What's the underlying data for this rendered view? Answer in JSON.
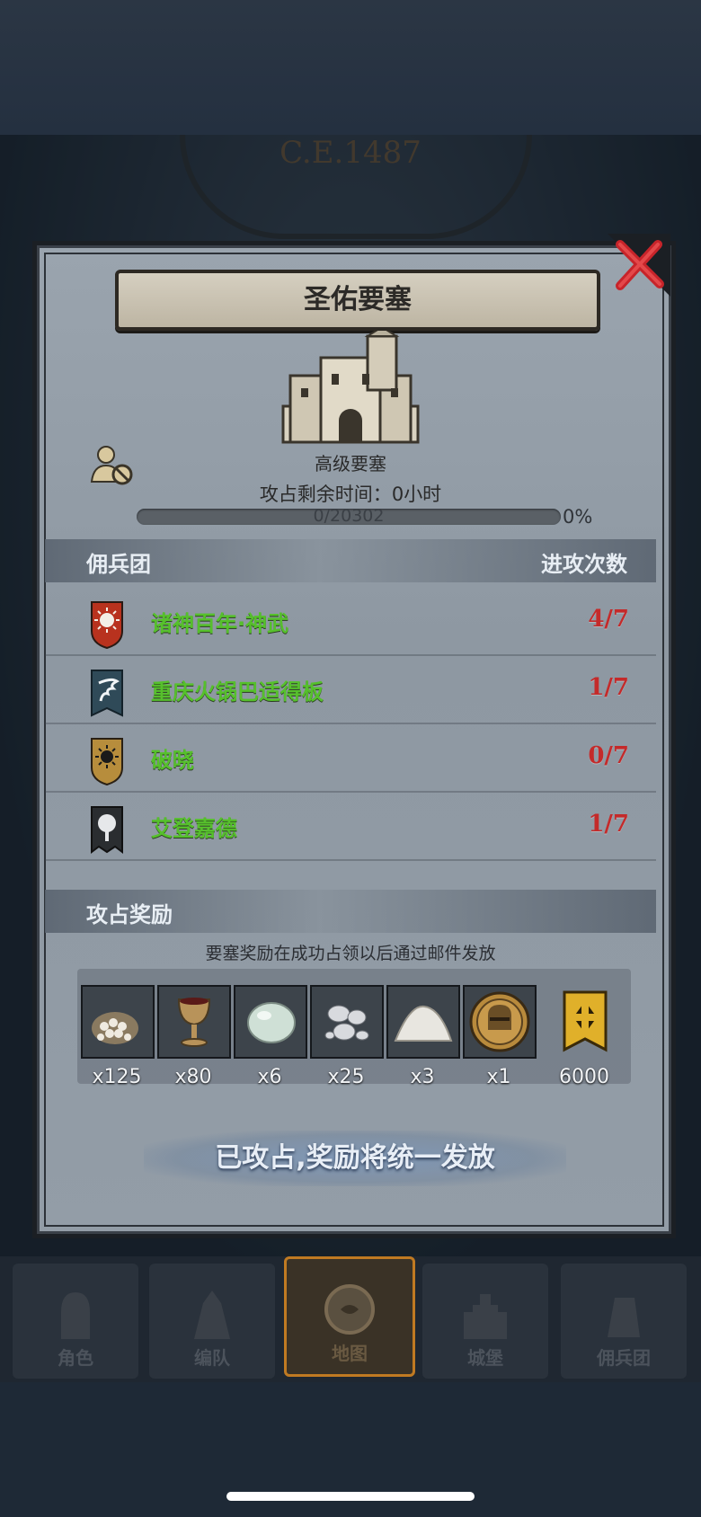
{
  "era": "C.E.1487",
  "dialog": {
    "title": "圣佑要塞",
    "castle_type": "高级要塞",
    "occupy_time_label": "攻占剩余时间：",
    "occupy_time_value": "0",
    "occupy_time_unit": "小时",
    "progress_text": "0/20302",
    "progress_pct": "0%",
    "progress_fraction": 0
  },
  "mercenary_section": {
    "label": "佣兵团",
    "count_label": "进攻次数"
  },
  "mercenaries": [
    {
      "name": "诸神百年·神武",
      "count": "4/7",
      "shield": "sun-shield-icon",
      "color": "#b8321e"
    },
    {
      "name": "重庆火锅巴适得板",
      "count": "1/7",
      "shield": "wing-banner-icon",
      "color": "#2f4a58"
    },
    {
      "name": "破晓",
      "count": "0/7",
      "shield": "dark-sun-shield-icon",
      "color": "#b78d3c"
    },
    {
      "name": "艾登嘉德",
      "count": "1/7",
      "shield": "tree-banner-icon",
      "color": "#2a2d30"
    }
  ],
  "reward_section": {
    "label": "攻占奖励",
    "note": "要塞奖励在成功占领以后通过邮件发放"
  },
  "rewards": [
    {
      "icon": "grain-sack-icon",
      "qty": "x125"
    },
    {
      "icon": "goblet-icon",
      "qty": "x80"
    },
    {
      "icon": "jade-stone-icon",
      "qty": "x6"
    },
    {
      "icon": "silver-ore-icon",
      "qty": "x25"
    },
    {
      "icon": "salt-pile-icon",
      "qty": "x3"
    },
    {
      "icon": "knight-helmet-coin-icon",
      "qty": "x1"
    },
    {
      "icon": "gold-banner-icon",
      "qty": "6000"
    }
  ],
  "claimed_text": "已攻占,奖励将统一发放",
  "nav": [
    {
      "label": "角色",
      "icon": "knight-icon"
    },
    {
      "label": "编队",
      "icon": "formation-icon"
    },
    {
      "label": "地图",
      "icon": "compass-map-icon"
    },
    {
      "label": "城堡",
      "icon": "castle-icon"
    },
    {
      "label": "佣兵团",
      "icon": "mercenary-icon"
    }
  ],
  "colors": {
    "guild_name": "#56c02c",
    "count": "#c42a2a",
    "active_nav": "#c07a22"
  }
}
